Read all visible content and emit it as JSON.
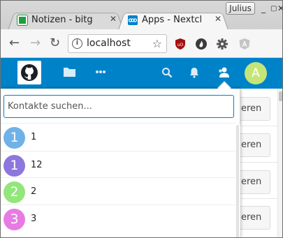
{
  "browser": {
    "profile_name": "Julius",
    "tabs": [
      {
        "title": "Notizen - bitg",
        "favicon_color": "#1f9e3c",
        "active": false
      },
      {
        "title": "Apps - Nextcl",
        "favicon_color": "#0082c9",
        "active": true
      }
    ],
    "window_buttons": [
      "minimize",
      "maximize",
      "close"
    ],
    "address": "localhost",
    "icons": [
      "back-icon",
      "forward-icon",
      "reload-icon",
      "info-icon",
      "star-icon"
    ]
  },
  "extensions": [
    {
      "name": "ublock-origin-icon",
      "color": "#a40f0f"
    },
    {
      "name": "flame-icon",
      "color": "#444444"
    },
    {
      "name": "gear-puzzle-icon",
      "color": "#555555"
    },
    {
      "name": "angular-icon",
      "color": "#9a9a9a"
    }
  ],
  "nextcloud": {
    "header_color": "#0082c9",
    "nav_icons": [
      "github-logo",
      "files-icon",
      "more-apps-icon",
      "search-icon",
      "notifications-icon",
      "contacts-icon"
    ],
    "avatar_letter": "A",
    "avatar_color": "#c6e577"
  },
  "background": {
    "button_label": "eren"
  },
  "contacts": {
    "search_placeholder": "Kontakte suchen...",
    "items": [
      {
        "initial": "1",
        "name": "1",
        "color": "#6fb2e8"
      },
      {
        "initial": "1",
        "name": "12",
        "color": "#8d77dd"
      },
      {
        "initial": "2",
        "name": "2",
        "color": "#92e67b"
      },
      {
        "initial": "3",
        "name": "3",
        "color": "#e77be3"
      }
    ]
  }
}
